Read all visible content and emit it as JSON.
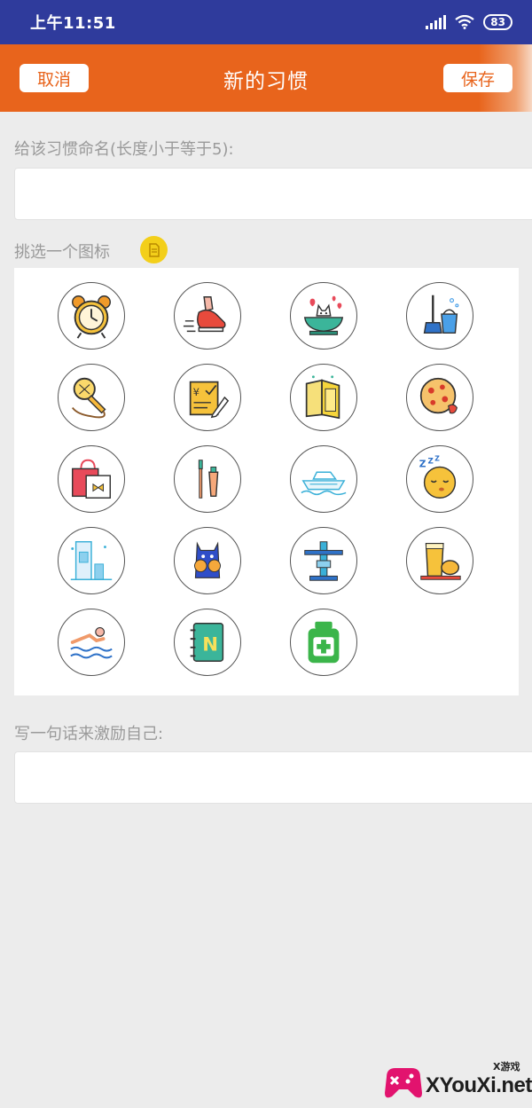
{
  "status_bar": {
    "time": "上午11:51",
    "battery": "83",
    "icons": [
      "signal-icon",
      "wifi-icon",
      "battery-icon"
    ]
  },
  "header": {
    "cancel_label": "取消",
    "title": "新的习惯",
    "save_label": "保存"
  },
  "form": {
    "name_label": "给该习惯命名(长度小于等于5):",
    "name_value": "",
    "icon_label": "挑选一个图标",
    "motto_label": "写一句话来激励自己:",
    "motto_value": ""
  },
  "icons": [
    "alarm-clock-icon",
    "running-shoe-icon",
    "cat-in-bowl-icon",
    "cleaning-bucket-icon",
    "microphone-icon",
    "finance-note-icon",
    "open-book-icon",
    "cookie-icon",
    "shopping-bag-icon",
    "toothbrush-toothpaste-icon",
    "yacht-icon",
    "sleeping-face-icon",
    "bathroom-shower-icon",
    "blue-cat-icon",
    "fitness-machine-icon",
    "juice-bread-icon",
    "swimmer-icon",
    "notebook-n-icon",
    "medicine-bottle-icon"
  ],
  "colors": {
    "status_bar": "#2f3b9c",
    "accent": "#e8641c",
    "background": "#ececec"
  },
  "watermark": {
    "brand": "XYouXi.net",
    "small": "X游戏"
  }
}
